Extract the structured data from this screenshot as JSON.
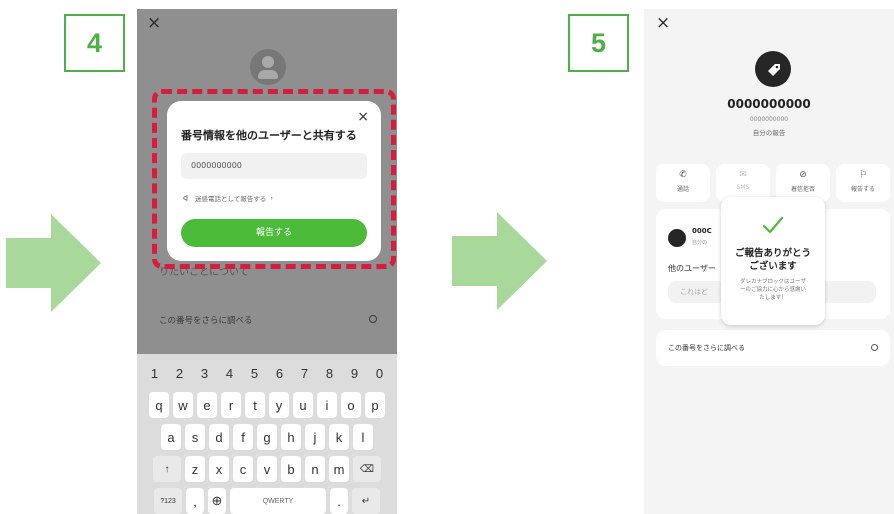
{
  "steps": {
    "left": "4",
    "right": "5"
  },
  "colors": {
    "accent_green": "#4fae4a",
    "button_green": "#4dbb3a",
    "highlight_red": "#d61d3d",
    "arrow_green": "#a8d89a"
  },
  "screen4": {
    "close_icon": "×",
    "behind_text": "りたいことについて",
    "search_text": "この番号をさらに調べる",
    "dialog": {
      "close_icon": "×",
      "title": "番号情報を他のユーザーと共有する",
      "number": "0000000000",
      "link_text": "迷惑電話として報告する",
      "button_label": "報告する"
    },
    "keyboard": {
      "numbers": [
        "1",
        "2",
        "3",
        "4",
        "5",
        "6",
        "7",
        "8",
        "9",
        "0"
      ],
      "row1": [
        "q",
        "w",
        "e",
        "r",
        "t",
        "y",
        "u",
        "i",
        "o",
        "p"
      ],
      "row2": [
        "a",
        "s",
        "d",
        "f",
        "g",
        "h",
        "j",
        "k",
        "l"
      ],
      "row3": [
        "z",
        "x",
        "c",
        "v",
        "b",
        "n",
        "m"
      ],
      "shift": "↑",
      "backspace": "⌫",
      "mode": "?123",
      "comma": ",",
      "globe": "⊕",
      "space": "QWERTY",
      "period": ".",
      "enter": "↵"
    }
  },
  "screen5": {
    "close_icon": "×",
    "number": "0000000000",
    "sub_number": "0000000000",
    "report_label": "自分の報告",
    "actions": [
      {
        "icon": "✆",
        "label": "通話"
      },
      {
        "icon": "✉",
        "label": "SMS"
      },
      {
        "icon": "⊘",
        "label": "着信拒否"
      },
      {
        "icon": "⚐",
        "label": "報告する"
      }
    ],
    "card": {
      "title": "000C",
      "sub": "自分の",
      "text": "他のユーザー",
      "input_placeholder": "これはど"
    },
    "search_text": "この番号をさらに調べる",
    "popup": {
      "title": "ご報告ありがとう\nございます",
      "body": "ダレカナブロックはユーザ\nーのご協力に心から感謝い\nたします！"
    }
  }
}
